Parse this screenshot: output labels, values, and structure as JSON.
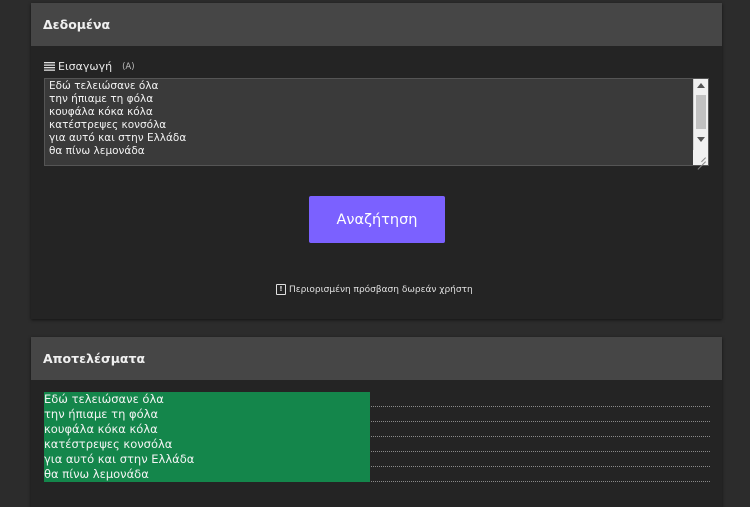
{
  "data_panel": {
    "title": "Δεδομένα",
    "input_label": "Εισαγωγή",
    "input_hint": "(A)",
    "input_lines": [
      "Εδώ τελειώσανε όλα",
      "την ήπιαμε τη φόλα",
      "κουφάλα κόκα κόλα",
      "κατέστρεψες κονσόλα",
      "για αυτό και στην Ελλάδα",
      "θα πίνω λεμονάδα"
    ],
    "search_button": "Αναζήτηση",
    "notice_icon": "!",
    "notice": "Περιορισμένη πρόσβαση δωρεάν χρήστη"
  },
  "results_panel": {
    "title": "Αποτελέσματα",
    "rows": [
      {
        "text": "Εδώ τελειώσανε όλα",
        "match": 0.49
      },
      {
        "text": "την ήπιαμε τη φόλα",
        "match": 0.49
      },
      {
        "text": "κουφάλα κόκα κόλα",
        "match": 0.49
      },
      {
        "text": "κατέστρεψες κονσόλα",
        "match": 0.49
      },
      {
        "text": "για αυτό και στην Ελλάδα",
        "match": 0.49
      },
      {
        "text": "θα πίνω λεμονάδα",
        "match": 0.49
      }
    ]
  },
  "colors": {
    "accent": "#7b61ff",
    "highlight": "#14864b",
    "background": "#2c2c2c",
    "panel": "#242424",
    "header": "#464646"
  },
  "icons": {
    "input_label": "lines-icon",
    "notice": "warning-icon"
  }
}
